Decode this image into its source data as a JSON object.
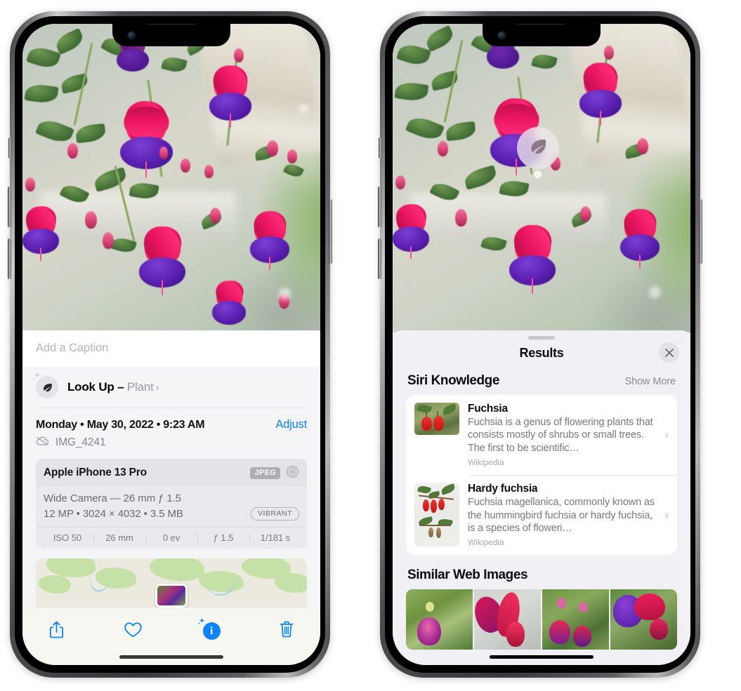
{
  "left_phone": {
    "caption_placeholder": "Add a Caption",
    "lookup": {
      "icon": "leaf-icon",
      "sparkle_icon": "sparkle-icon",
      "label": "Look Up –",
      "subject": "Plant",
      "chevron": "›"
    },
    "meta": {
      "date": "Monday • May 30, 2022 • 9:23 AM",
      "adjust_label": "Adjust",
      "cloud_icon": "icloud-slash-icon",
      "file_name": "IMG_4241"
    },
    "exif": {
      "device": "Apple iPhone 13 Pro",
      "format_badge": "JPEG",
      "aperture_icon": "aperture-icon",
      "lens_line": "Wide Camera — 26 mm ƒ 1.5",
      "size_line": "12 MP • 3024 × 4032 • 3.5 MB",
      "style_badge": "VIBRANT",
      "stats": [
        "ISO 50",
        "26 mm",
        "0 ev",
        "ƒ 1.5",
        "1/181 s"
      ]
    },
    "map": {
      "name": "location-map"
    },
    "toolbar": [
      {
        "name": "share-button",
        "icon": "share-icon"
      },
      {
        "name": "favorite-button",
        "icon": "heart-icon"
      },
      {
        "name": "info-button",
        "icon": "info-sparkle-icon",
        "glyph": "i"
      },
      {
        "name": "delete-button",
        "icon": "trash-icon"
      }
    ]
  },
  "right_phone": {
    "photo_badge": {
      "icon": "leaf-icon",
      "name": "visual-lookup-badge"
    },
    "sheet": {
      "title": "Results",
      "close_label": "✕",
      "sections": [
        {
          "title": "Siri Knowledge",
          "action": "Show More",
          "items": [
            {
              "title": "Fuchsia",
              "description": "Fuchsia is a genus of flowering plants that consists mostly of shrubs or small trees. The first to be scientific…",
              "source": "Wikipedia",
              "chevron": "›"
            },
            {
              "title": "Hardy fuchsia",
              "description": "Fuchsia magellanica, commonly known as the hummingbird fuchsia or hardy fuchsia, is a species of floweri…",
              "source": "Wikipedia",
              "chevron": "›"
            }
          ]
        },
        {
          "title": "Similar Web Images",
          "thumbnails": [
            "web-image-1",
            "web-image-2",
            "web-image-3",
            "web-image-4"
          ]
        }
      ]
    }
  },
  "colors": {
    "accent_blue": "#0a84ff",
    "panel_bg": "#f5f5f7",
    "sheet_bg": "#f1f1f5",
    "card_bg": "#ffffff",
    "secondary_text": "#86868b",
    "badge_gray": "#aeaeb4"
  }
}
